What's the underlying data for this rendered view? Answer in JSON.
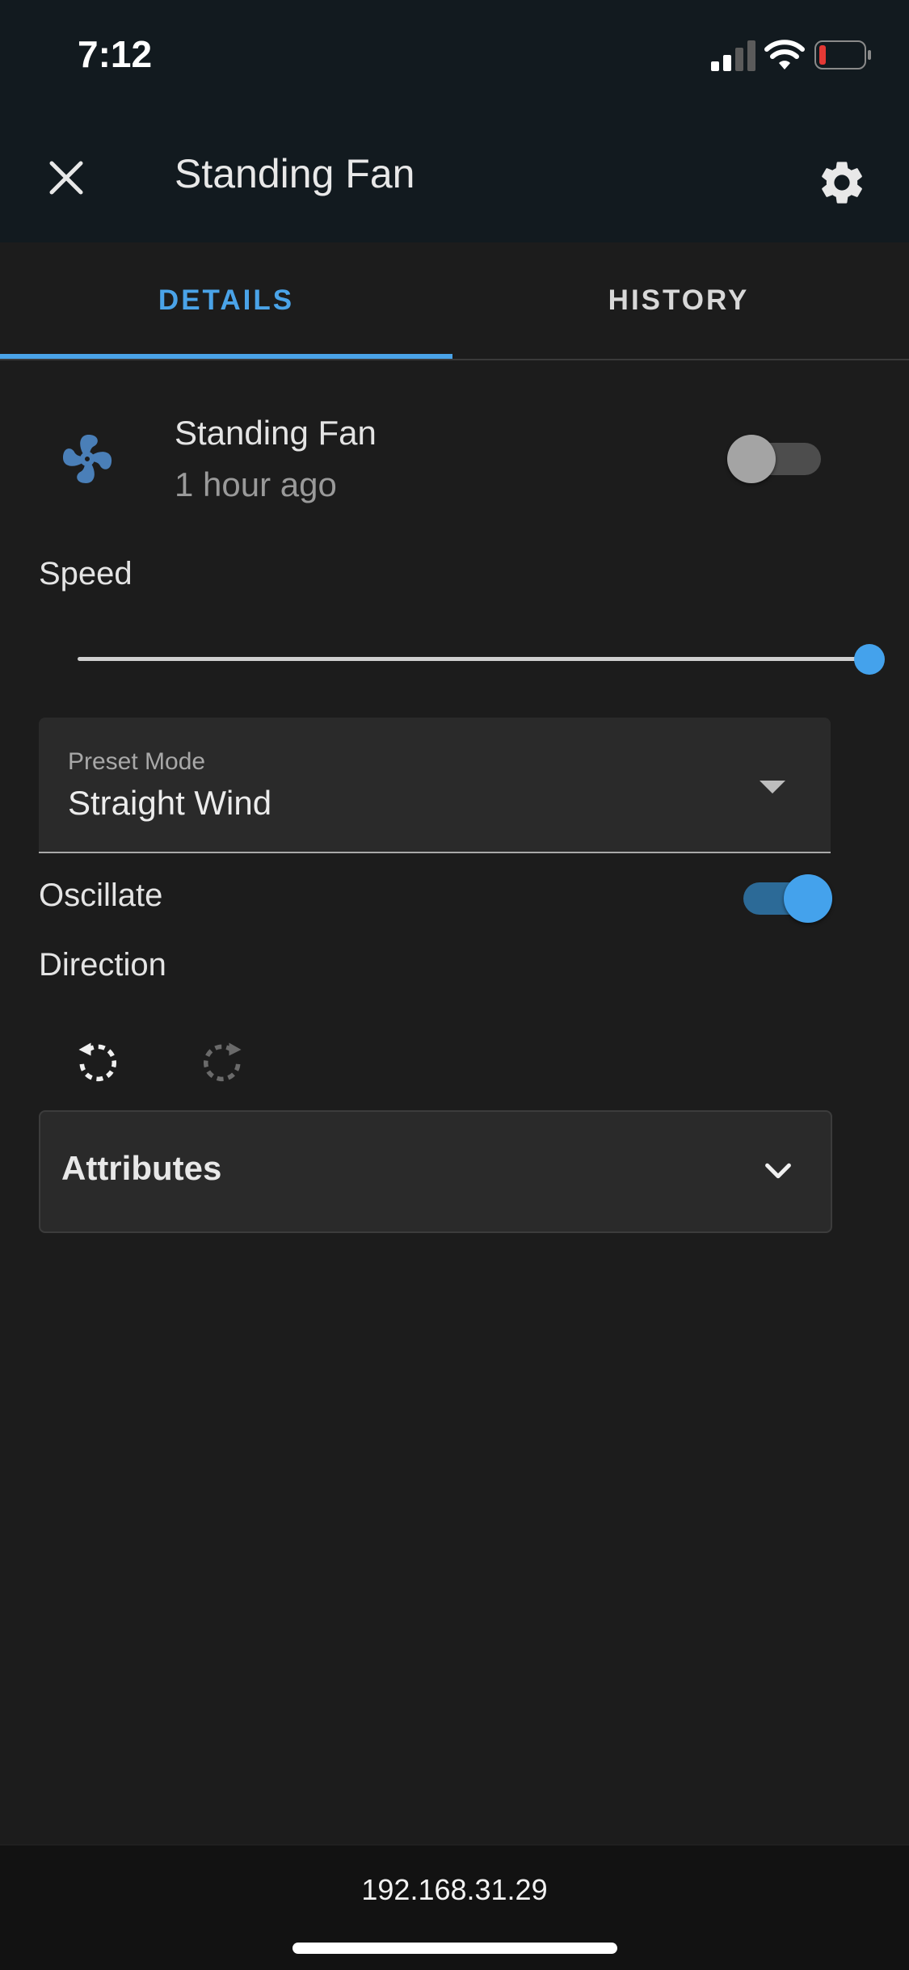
{
  "status_bar": {
    "time": "7:12",
    "icons": [
      "cellular-signal-icon",
      "wifi-icon",
      "battery-low-icon"
    ],
    "battery_color": "#e53935"
  },
  "app_bar": {
    "title": "Standing Fan",
    "close_icon": "close-icon",
    "settings_icon": "gear-icon"
  },
  "tabs": [
    {
      "label": "DETAILS",
      "active": true
    },
    {
      "label": "HISTORY",
      "active": false
    }
  ],
  "entity": {
    "icon": "fan-icon",
    "name": "Standing Fan",
    "last_changed": "1 hour ago",
    "power_on": false
  },
  "speed": {
    "label": "Speed",
    "value_percent": 100
  },
  "preset_mode": {
    "label": "Preset Mode",
    "value": "Straight Wind"
  },
  "oscillate": {
    "label": "Oscillate",
    "on": true
  },
  "direction": {
    "label": "Direction",
    "buttons": [
      "rotate-left-icon",
      "rotate-right-icon"
    ]
  },
  "attributes": {
    "title": "Attributes",
    "icon": "chevron-down-icon"
  },
  "footer": {
    "host": "192.168.31.29"
  },
  "colors": {
    "accent": "#4aa3e8",
    "background": "#1c1c1c",
    "header": "#121a1f",
    "fan_icon": "#4a7fb8"
  }
}
